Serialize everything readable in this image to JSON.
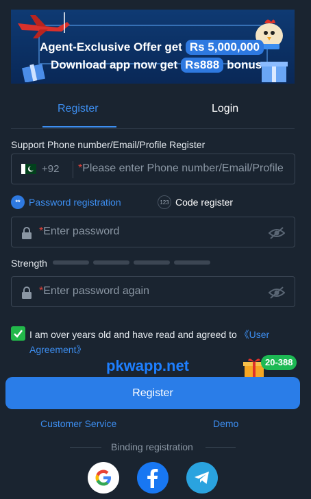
{
  "banner": {
    "line1_text": "Agent-Exclusive Offer get",
    "line1_amount": "Rs 5,000,000",
    "line2_text": "Download app now get",
    "line2_amount": "Rs888",
    "line2_suffix": "bonus"
  },
  "tabs": [
    {
      "label": "Register",
      "active": true
    },
    {
      "label": "Login",
      "active": false
    }
  ],
  "form": {
    "support_label": "Support Phone number/Email/Profile Register",
    "country_code": "+92",
    "phone_placeholder": "Please enter Phone number/Email/Profile",
    "options": {
      "password_registration": "Password registration",
      "password_icon_text": "**",
      "code_register": "Code register",
      "code_icon_text": "123"
    },
    "password_placeholder": "Enter password",
    "strength_label": "Strength",
    "password_again_placeholder": "Enter password again",
    "required_mark": "*",
    "agree_text": "I am over years old and have read and agreed to",
    "agree_link": "《User Agreement》",
    "agree_checked": true
  },
  "watermark": "pkwapp.net",
  "promo_badge": "20-388",
  "register_button": "Register",
  "links": {
    "customer_service": "Customer Service",
    "demo": "Demo"
  },
  "binding_label": "Binding registration",
  "social": [
    "google-icon",
    "facebook-icon",
    "telegram-icon"
  ],
  "colors": {
    "background": "#1a2430",
    "accent": "#2a7de8",
    "link": "#3d8ef0",
    "check": "#22b84a",
    "required": "#e0433a"
  }
}
